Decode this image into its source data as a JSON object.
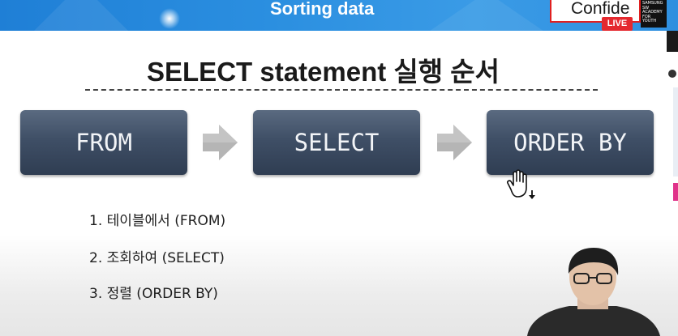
{
  "banner": {
    "title": "Sorting data",
    "confidential_text": "Confide",
    "live_badge": "LIVE",
    "logo_text": "SAMSUNG SW ACADEMY FOR YOUTH"
  },
  "slide": {
    "title": "SELECT statement 실행 순서",
    "steps": [
      {
        "label": "FROM"
      },
      {
        "label": "SELECT"
      },
      {
        "label": "ORDER BY"
      }
    ],
    "list": [
      "1. 테이블에서 (FROM)",
      "2. 조회하여 (SELECT)",
      "3. 정렬 (ORDER BY)"
    ]
  },
  "icons": {
    "arrow": "right-arrow-icon",
    "cursor": "hand-cursor-icon"
  },
  "colors": {
    "banner_blue": "#2b8fe0",
    "box_top": "#5a6a80",
    "box_bottom": "#2f3d52",
    "live_red": "#e4292f"
  }
}
